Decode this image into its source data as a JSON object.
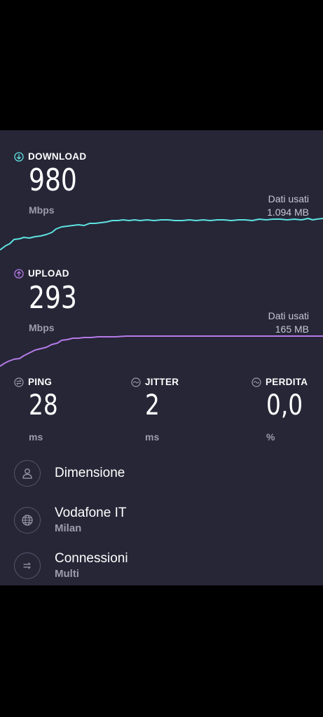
{
  "download": {
    "label": "DOWNLOAD",
    "value": "980",
    "unit": "Mbps",
    "data_used_label": "Dati usati",
    "data_used_value": "1.094 MB",
    "color": "#5ee3e0",
    "icon": "download-arrow-icon"
  },
  "upload": {
    "label": "UPLOAD",
    "value": "293",
    "unit": "Mbps",
    "data_used_label": "Dati usati",
    "data_used_value": "165 MB",
    "color": "#b57be8",
    "icon": "upload-arrow-icon"
  },
  "ping": {
    "label": "PING",
    "value": "28",
    "unit": "ms",
    "icon": "ping-icon"
  },
  "jitter": {
    "label": "JITTER",
    "value": "2",
    "unit": "ms",
    "icon": "jitter-icon"
  },
  "loss": {
    "label": "PERDITA",
    "value": "0,0",
    "unit": "%",
    "icon": "packet-loss-icon"
  },
  "info": {
    "dimension": {
      "title": "Dimensione",
      "icon": "user-icon"
    },
    "provider": {
      "title": "Vodafone IT",
      "subtitle": "Milan",
      "icon": "globe-icon"
    },
    "connections": {
      "title": "Connessioni",
      "subtitle": "Multi",
      "icon": "connections-icon"
    }
  },
  "colors": {
    "background": "#262637",
    "muted_text": "#9b9cad",
    "icon_gray": "#9b9cad"
  }
}
